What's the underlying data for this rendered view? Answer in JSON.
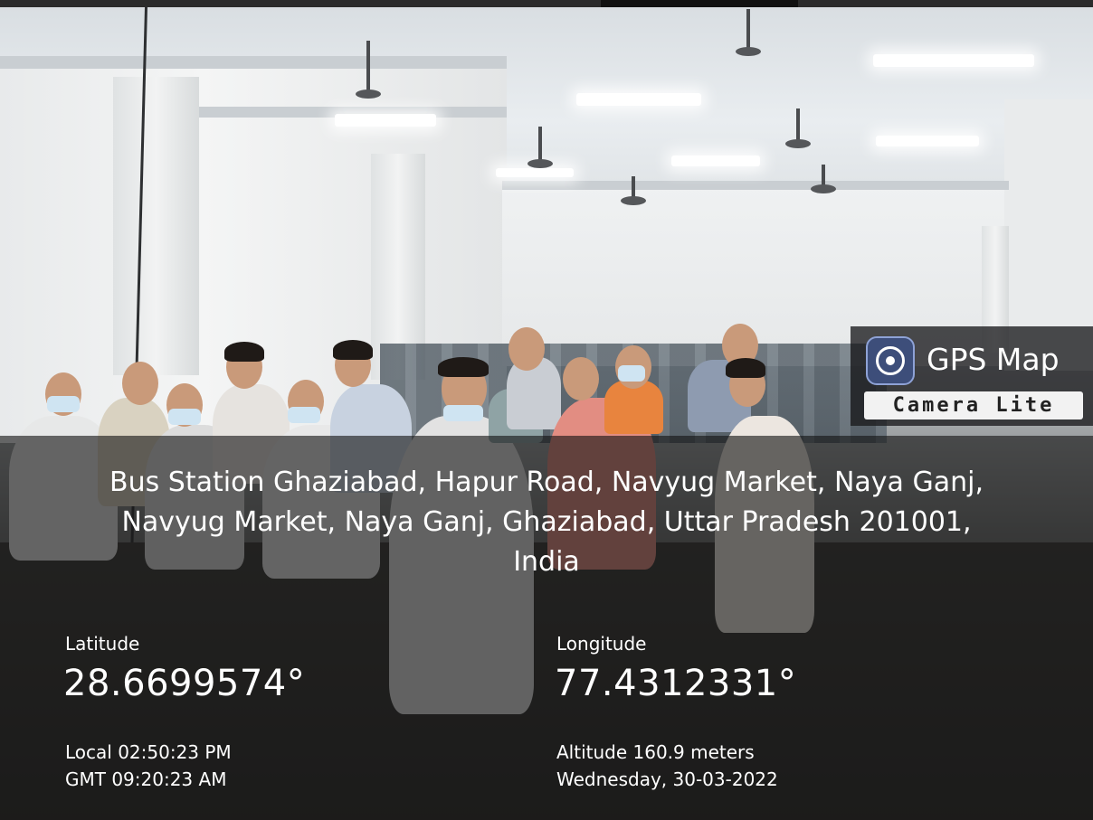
{
  "badge": {
    "app_name": "GPS Map",
    "app_edition": "Camera Lite",
    "icon": "camera-lens-icon"
  },
  "address": {
    "line1": "Bus Station Ghaziabad, Hapur Road, Navyug Market, Naya Ganj,",
    "line2": "Navyug Market, Naya Ganj, Ghaziabad, Uttar Pradesh 201001,",
    "line3": "India"
  },
  "coordinates": {
    "latitude_label": "Latitude",
    "latitude_value": "28.6699574°",
    "longitude_label": "Longitude",
    "longitude_value": "77.4312331°"
  },
  "time": {
    "local": "Local 02:50:23 PM",
    "gmt": "GMT 09:20:23 AM"
  },
  "meta": {
    "altitude": "Altitude 160.9 meters",
    "date": "Wednesday, 30-03-2022"
  }
}
